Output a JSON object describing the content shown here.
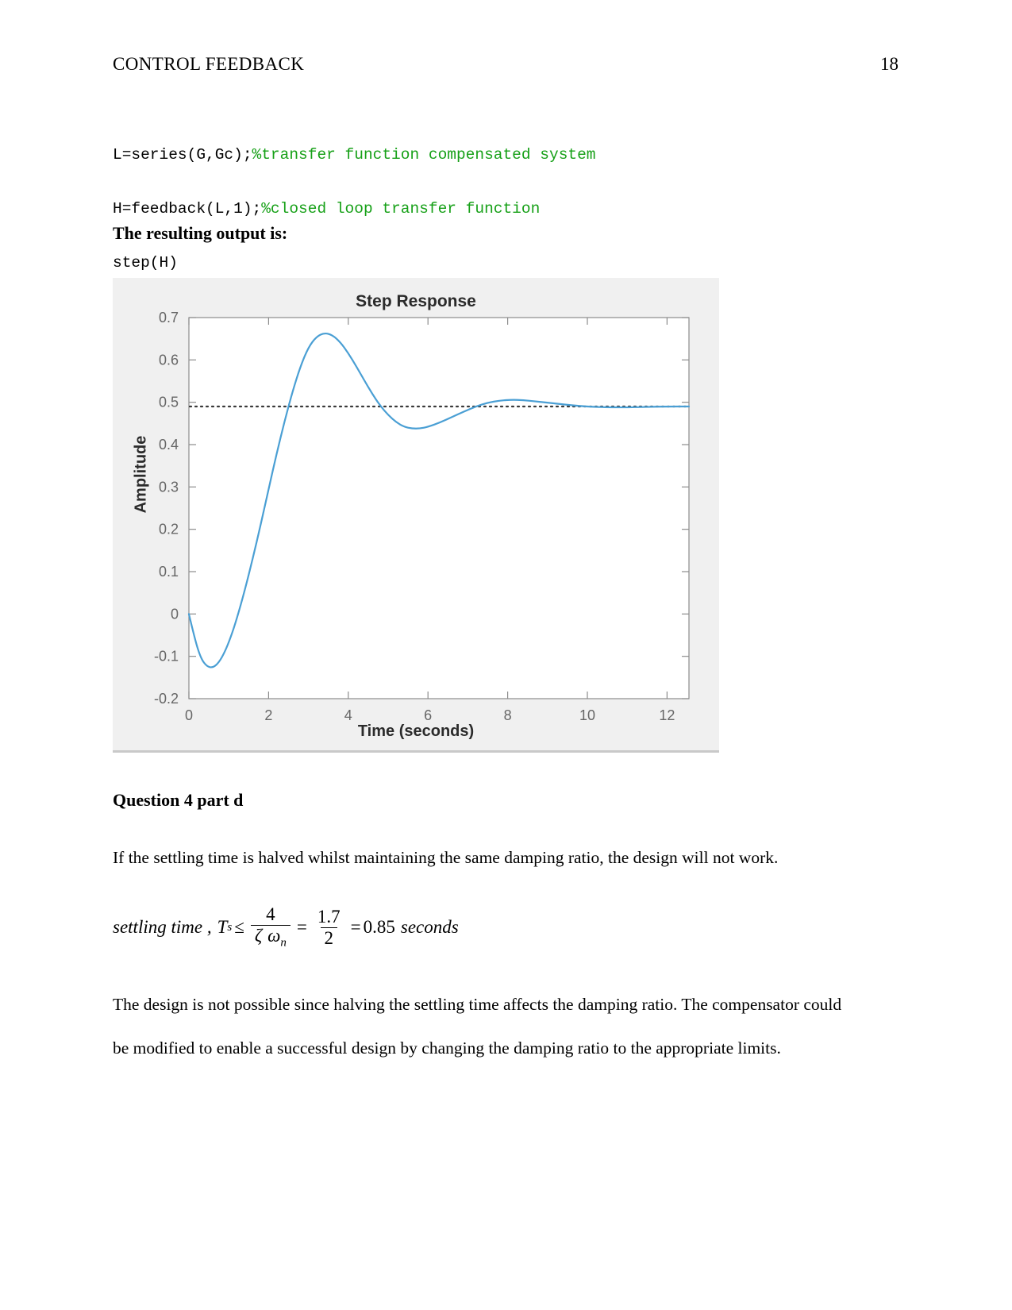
{
  "header": {
    "title": "CONTROL FEEDBACK",
    "page_number": "18"
  },
  "code_block": {
    "lines": [
      {
        "code": "L=series(G,Gc);",
        "comment": "%transfer function compensated system"
      },
      {
        "code": "H=feedback(L,1);",
        "comment": "%closed loop transfer function"
      },
      {
        "code": "step(H)",
        "comment": ""
      }
    ],
    "comment_color": "#16a017"
  },
  "lead_in": "The resulting output is:",
  "question": {
    "heading": "Question 4 part d",
    "paragraph_1": "If the settling time is halved whilst maintaining the same damping ratio, the design will not work.",
    "paragraph_2": "The design is not possible since halving the settling time affects the damping ratio. The compensator could be modified to enable a successful design by changing the damping ratio to the appropriate limits."
  },
  "equation": {
    "lead": "settling time ,",
    "symbol": "T",
    "symbol_sub": "s",
    "relation": "≤",
    "frac1_num": "4",
    "frac1_den_zeta": "ζ",
    "frac1_den_omega": "ω",
    "frac1_den_omega_sub": "n",
    "equals_1": "=",
    "frac2_num": "1.7",
    "frac2_den": "2",
    "equals_2": "=",
    "result": "0.85",
    "units": "seconds"
  },
  "chart_data": {
    "type": "line",
    "title": "Step Response",
    "xlabel": "Time (seconds)",
    "ylabel": "Amplitude",
    "xlim": [
      0,
      12.55
    ],
    "ylim": [
      -0.2,
      0.7
    ],
    "xticks": [
      0,
      2,
      4,
      6,
      8,
      10,
      12
    ],
    "yticks": [
      -0.2,
      -0.1,
      0,
      0.1,
      0.2,
      0.3,
      0.4,
      0.5,
      0.6,
      0.7
    ],
    "grid": false,
    "legend": null,
    "line_color": "#4a9fd4",
    "reference_line": {
      "value": 0.49,
      "style": "dotted",
      "color": "#3a3a3a"
    },
    "series": [
      {
        "name": "step response",
        "x": [
          0,
          0.15,
          0.3,
          0.45,
          0.6,
          0.75,
          0.9,
          1.05,
          1.2,
          1.4,
          1.6,
          1.8,
          2.0,
          2.2,
          2.4,
          2.6,
          2.8,
          3.0,
          3.2,
          3.4,
          3.6,
          3.8,
          4.0,
          4.2,
          4.4,
          4.6,
          4.8,
          5.0,
          5.2,
          5.4,
          5.6,
          5.8,
          6.0,
          6.3,
          6.6,
          6.9,
          7.2,
          7.5,
          7.8,
          8.1,
          8.4,
          8.7,
          9.0,
          9.4,
          9.8,
          10.2,
          10.6,
          11.0,
          11.5,
          12.0,
          12.55
        ],
        "y": [
          0.0,
          -0.06,
          -0.105,
          -0.124,
          -0.127,
          -0.115,
          -0.09,
          -0.055,
          -0.012,
          0.055,
          0.13,
          0.21,
          0.295,
          0.378,
          0.455,
          0.525,
          0.585,
          0.63,
          0.655,
          0.664,
          0.659,
          0.642,
          0.616,
          0.585,
          0.552,
          0.52,
          0.492,
          0.47,
          0.453,
          0.442,
          0.438,
          0.438,
          0.442,
          0.452,
          0.465,
          0.478,
          0.49,
          0.499,
          0.504,
          0.506,
          0.505,
          0.502,
          0.499,
          0.495,
          0.491,
          0.489,
          0.488,
          0.488,
          0.489,
          0.49,
          0.49
        ]
      }
    ],
    "annotations": {
      "peak_value": 0.665,
      "peak_time": 3.4,
      "undershoot_value": -0.127,
      "undershoot_time": 0.6,
      "second_trough_value": 0.438,
      "second_trough_time": 5.7,
      "steady_state": 0.49
    }
  }
}
